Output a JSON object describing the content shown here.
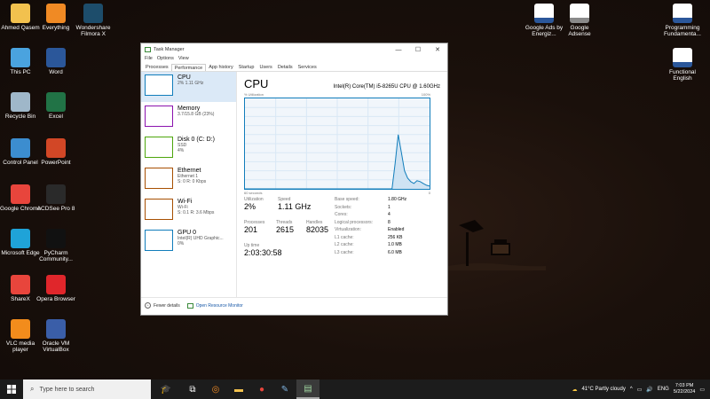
{
  "desktop": {
    "icons_left": [
      {
        "label": "Ahmed Qasem",
        "icon": "folder-icon",
        "color": "#f2c14e"
      },
      {
        "label": "Everything",
        "icon": "magnifier-icon",
        "color": "#f08a24"
      },
      {
        "label": "Wondershare Filmora X",
        "icon": "filmora-icon",
        "color": "#1d4d6b"
      },
      {
        "label": "This PC",
        "icon": "computer-icon",
        "color": "#4aa3df"
      },
      {
        "label": "Word",
        "icon": "word-icon",
        "color": "#2b579a"
      },
      {
        "label": "Recycle Bin",
        "icon": "recycle-bin-icon",
        "color": "#9fb7c9"
      },
      {
        "label": "Excel",
        "icon": "excel-icon",
        "color": "#217346"
      },
      {
        "label": "Control Panel",
        "icon": "control-panel-icon",
        "color": "#3c8dcf"
      },
      {
        "label": "PowerPoint",
        "icon": "powerpoint-icon",
        "color": "#d24726"
      },
      {
        "label": "Google Chrome",
        "icon": "chrome-icon",
        "color": "#e8453c"
      },
      {
        "label": "ACDSee Pro 8",
        "icon": "acdsee-icon",
        "color": "#2a2a2a"
      },
      {
        "label": "Microsoft Edge",
        "icon": "edge-icon",
        "color": "#1fa3d8"
      },
      {
        "label": "PyCharm Community...",
        "icon": "pycharm-icon",
        "color": "#111"
      },
      {
        "label": "ShareX",
        "icon": "sharex-icon",
        "color": "#e8453c"
      },
      {
        "label": "Opera Browser",
        "icon": "opera-icon",
        "color": "#e0262b"
      },
      {
        "label": "VLC media player",
        "icon": "vlc-icon",
        "color": "#f28c1c"
      },
      {
        "label": "Oracle VM VirtualBox",
        "icon": "virtualbox-icon",
        "color": "#3a5ea8"
      }
    ],
    "icons_right": [
      {
        "label": "Google Ads by Energiz...",
        "icon": "word-doc-icon",
        "color": "#2b579a"
      },
      {
        "label": "Google Adsense",
        "icon": "image-file-icon",
        "color": "#8a8a8a"
      },
      {
        "label": "Programming Fundamenta...",
        "icon": "word-doc-icon",
        "color": "#2b579a"
      },
      {
        "label": "Functional English",
        "icon": "word-doc-icon",
        "color": "#2b579a"
      }
    ]
  },
  "taskmanager": {
    "title": "Task Manager",
    "menu": [
      "File",
      "Options",
      "View"
    ],
    "tabs": [
      "Processes",
      "Performance",
      "App history",
      "Startup",
      "Users",
      "Details",
      "Services"
    ],
    "active_tab": "Performance",
    "sidebar": [
      {
        "name": "CPU",
        "sub1": "2% 1.11 GHz",
        "sub2": "",
        "color": "#117dbb"
      },
      {
        "name": "Memory",
        "sub1": "3.7/15.8 GB (23%)",
        "sub2": "",
        "color": "#8b12ae"
      },
      {
        "name": "Disk 0 (C: D:)",
        "sub1": "SSD",
        "sub2": "4%",
        "color": "#4da60c"
      },
      {
        "name": "Ethernet",
        "sub1": "Ethernet 1",
        "sub2": "S: 0 R: 0 Kbps",
        "color": "#a74f01"
      },
      {
        "name": "Wi-Fi",
        "sub1": "Wi-Fi",
        "sub2": "S: 0.1 R: 3.6 Mbps",
        "color": "#a74f01"
      },
      {
        "name": "GPU 0",
        "sub1": "Intel(R) UHD Graphic...",
        "sub2": "0%",
        "color": "#117dbb"
      }
    ],
    "cpu": {
      "heading": "CPU",
      "model": "Intel(R) Core(TM) i5-8265U CPU @ 1.60GHz",
      "graph_label_left": "% Utilization",
      "graph_label_right": "100%",
      "graph_foot_left": "60 seconds",
      "graph_foot_right": "0",
      "utilization_label": "Utilization",
      "utilization": "2%",
      "speed_label": "Speed",
      "speed": "1.11 GHz",
      "processes_label": "Processes",
      "processes": "201",
      "threads_label": "Threads",
      "threads": "2615",
      "handles_label": "Handles",
      "handles": "82035",
      "uptime_label": "Up time",
      "uptime": "2:03:30:58",
      "specs": [
        {
          "k": "Base speed:",
          "v": "1.80 GHz"
        },
        {
          "k": "Sockets:",
          "v": "1"
        },
        {
          "k": "Cores:",
          "v": "4"
        },
        {
          "k": "Logical processors:",
          "v": "8"
        },
        {
          "k": "Virtualization:",
          "v": "Enabled"
        },
        {
          "k": "L1 cache:",
          "v": "256 KB"
        },
        {
          "k": "L2 cache:",
          "v": "1.0 MB"
        },
        {
          "k": "L3 cache:",
          "v": "6.0 MB"
        }
      ],
      "usage_history": [
        0,
        0,
        0,
        0,
        0,
        0,
        0,
        0,
        0,
        0,
        0,
        0,
        0,
        0,
        0,
        0,
        0,
        0,
        0,
        0,
        0,
        0,
        0,
        0,
        0,
        0,
        0,
        0,
        0,
        0,
        0,
        0,
        0,
        0,
        0,
        0,
        0,
        0,
        0,
        0,
        0,
        0,
        0,
        0,
        0,
        0,
        0,
        0,
        28,
        60,
        40,
        20,
        12,
        8,
        6,
        9,
        8,
        6,
        4,
        3
      ]
    },
    "footer": {
      "fewer": "Fewer details",
      "monitor": "Open Resource Monitor"
    }
  },
  "taskbar": {
    "search_placeholder": "Type here to search",
    "weather": "41°C  Partly cloudy",
    "lang": "ENG",
    "time": "7:03 PM",
    "date": "5/22/2024"
  }
}
